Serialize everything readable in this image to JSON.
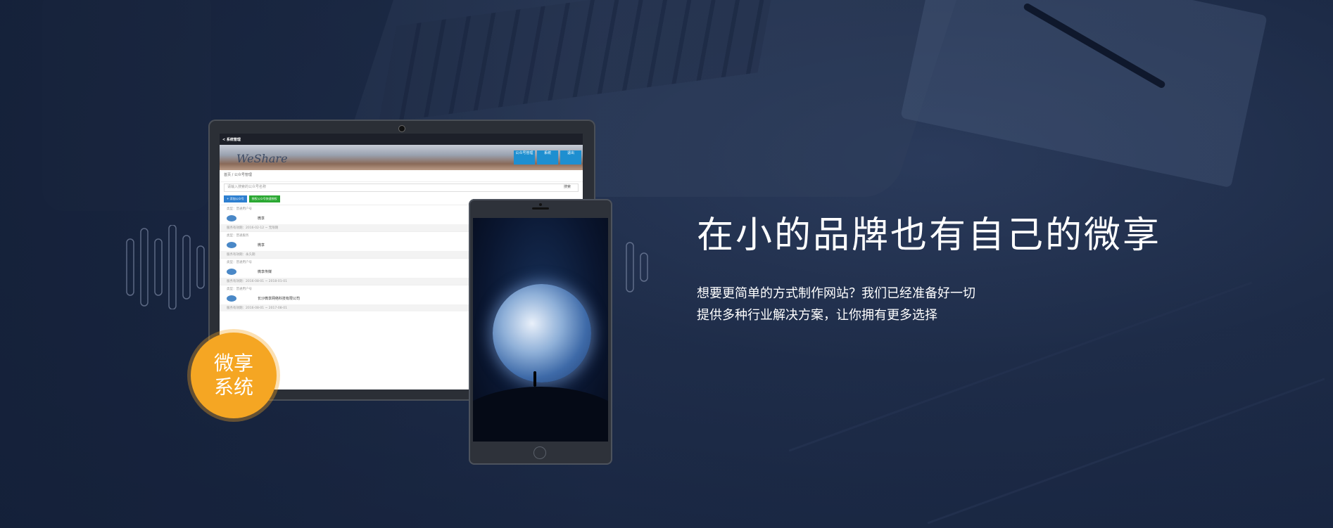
{
  "hero": {
    "headline": "在小的品牌也有自己的微享",
    "subtitle_line1": "想要更简单的方式制作网站？我们已经准备好一切",
    "subtitle_line2": "提供多种行业解决方案，让你拥有更多选择",
    "badge_line1": "微享",
    "badge_line2": "系统"
  },
  "tablet_ui": {
    "brand": "< 系统管理",
    "logo": "WeShare",
    "banner_buttons": [
      "公众号管理",
      "系统",
      "退出"
    ],
    "breadcrumb": "首页 / 公众号管理",
    "search_placeholder": "请输入搜索的公众号名称",
    "search_button": "搜索",
    "action_primary": "+ 添加公众号",
    "action_secondary": "授权公众号快速授权",
    "items": [
      {
        "head": "类型：普通用户号",
        "name": "微享",
        "foot": "服务有效期：2016-02-12 ~ 无限期"
      },
      {
        "head": "类型：普通服务",
        "name": "微享",
        "foot": "服务有效期：永久期"
      },
      {
        "head": "类型：普通用户号",
        "name": "微享传媒",
        "foot": "服务有效期：2016-08-01 ~ 2018-01-01"
      },
      {
        "head": "类型：普通用户号",
        "name": "长沙微享网络科技有限公司",
        "foot": "服务有效期：2016-08-01 ~ 2017-08-01"
      }
    ]
  },
  "colors": {
    "badge": "#f5a623",
    "background": "#1b2944"
  }
}
